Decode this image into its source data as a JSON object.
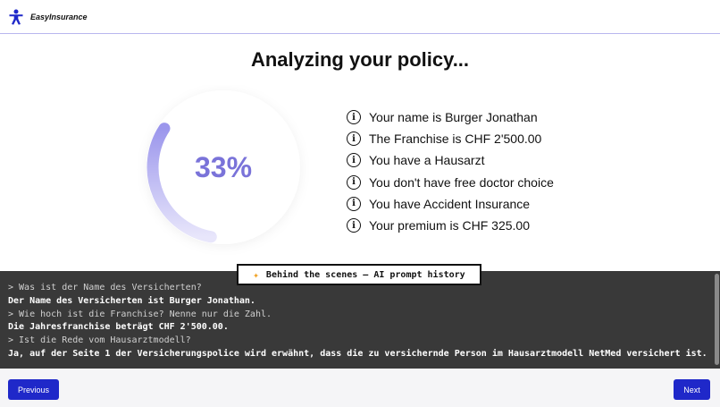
{
  "header": {
    "brand": "EasyInsurance",
    "logo_icon": "person-logo-icon"
  },
  "page": {
    "title": "Analyzing your policy..."
  },
  "progress": {
    "label": "33%",
    "value": 0.33,
    "color": "#7a73d9"
  },
  "facts": [
    {
      "icon": "info-icon",
      "text": "Your name is Burger Jonathan"
    },
    {
      "icon": "info-icon",
      "text": "The Franchise is CHF 2'500.00"
    },
    {
      "icon": "info-icon",
      "text": "You have a Hausarzt"
    },
    {
      "icon": "info-icon",
      "text": "You don't have free doctor choice"
    },
    {
      "icon": "info-icon",
      "text": "You have Accident Insurance"
    },
    {
      "icon": "info-icon",
      "text": "Your premium is CHF 325.00"
    }
  ],
  "console": {
    "label": "Behind the scenes – AI prompt history",
    "label_icon": "sparkle-icon",
    "lines": [
      {
        "type": "prompt",
        "text": "> Was ist der Name des Versicherten?"
      },
      {
        "type": "answer",
        "text": "Der Name des Versicherten ist Burger Jonathan."
      },
      {
        "type": "prompt",
        "text": "> Wie hoch ist die Franchise? Nenne nur die Zahl."
      },
      {
        "type": "answer",
        "text": "Die Jahresfranchise beträgt CHF 2'500.00."
      },
      {
        "type": "prompt",
        "text": "> Ist die Rede vom Hausarztmodell?"
      },
      {
        "type": "answer",
        "text": "Ja, auf der Seite 1 der Versicherungspolice wird erwähnt, dass die zu versichernde Person im Hausarztmodell NetMed versichert ist."
      }
    ]
  },
  "footer": {
    "previous_label": "Previous",
    "next_label": "Next"
  },
  "colors": {
    "accent": "#1f28c9",
    "progress": "#7a73d9",
    "console_bg": "#393939"
  }
}
